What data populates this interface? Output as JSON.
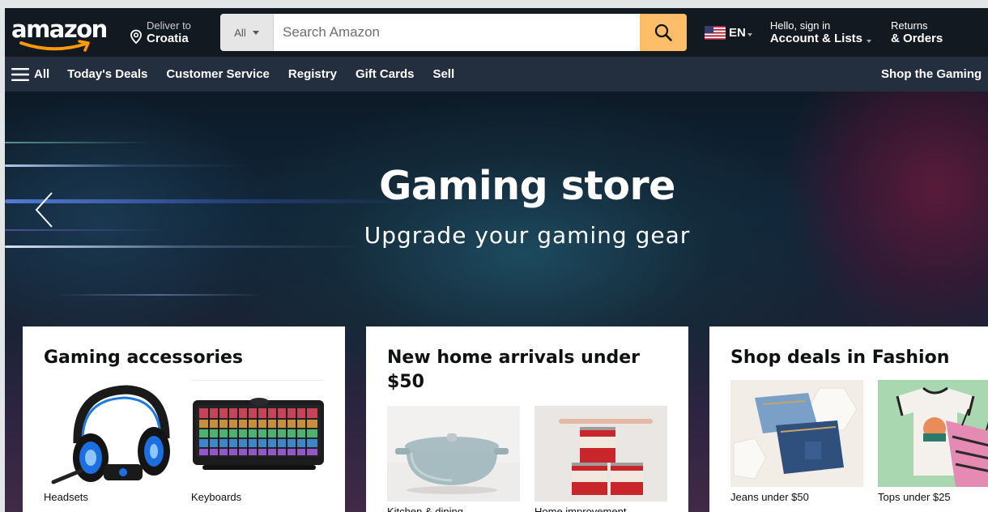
{
  "header": {
    "logo": "amazon",
    "deliver_line1": "Deliver to",
    "deliver_line2": "Croatia",
    "search_category": "All",
    "search_placeholder": "Search Amazon",
    "language": "EN",
    "account_line1": "Hello, sign in",
    "account_line2": "Account & Lists",
    "returns_line1": "Returns",
    "returns_line2": "& Orders"
  },
  "subnav": {
    "all_label": "All",
    "links": [
      "Today's Deals",
      "Customer Service",
      "Registry",
      "Gift Cards",
      "Sell"
    ],
    "promo": "Shop the Gaming"
  },
  "hero": {
    "title": "Gaming store",
    "subtitle": "Upgrade your gaming gear"
  },
  "cards": [
    {
      "title": "Gaming accessories",
      "tiles": [
        {
          "label": "Headsets",
          "icon": "headset-image"
        },
        {
          "label": "Keyboards",
          "icon": "keyboard-image"
        }
      ]
    },
    {
      "title": "New home arrivals under $50",
      "tiles": [
        {
          "label": "Kitchen & dining",
          "icon": "dutch-oven-image"
        },
        {
          "label": "Home improvement",
          "icon": "paint-cans-image"
        }
      ]
    },
    {
      "title": "Shop deals in Fashion",
      "tiles": [
        {
          "label": "Jeans under $50",
          "icon": "jeans-image"
        },
        {
          "label": "Tops under $25",
          "icon": "tops-image"
        }
      ]
    }
  ],
  "colors": {
    "nav_belt": "#131921",
    "nav_main": "#232f3e",
    "search_button": "#febd69",
    "logo_smile": "#ff9900"
  }
}
